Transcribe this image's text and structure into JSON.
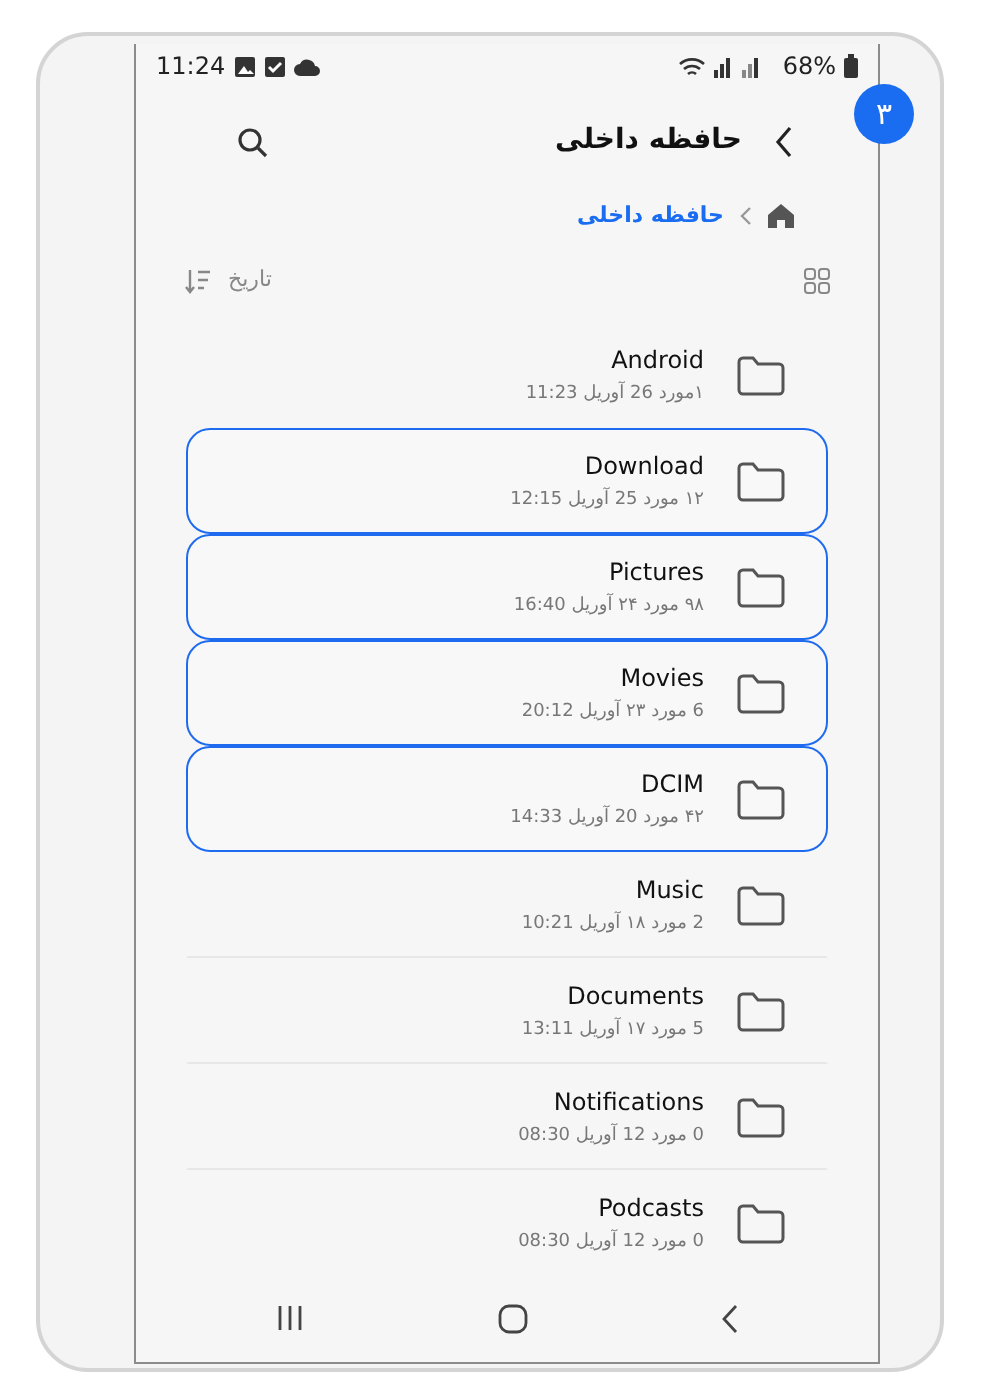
{
  "status_bar": {
    "time": "11:24",
    "battery": "68%"
  },
  "step_badge": "۳",
  "header": {
    "title": "حافظه داخلی"
  },
  "breadcrumb": [
    {
      "label": "حافظه داخلی"
    }
  ],
  "sort": {
    "label": "تاریخ"
  },
  "folders": [
    {
      "name": "Android",
      "meta": "۱مورد 26 آوریل 11:23",
      "selected": false
    },
    {
      "name": "Download",
      "meta": "۱۲ مورد 25 آوریل 12:15",
      "selected": true
    },
    {
      "name": "Pictures",
      "meta": "۹۸ مورد ۲۴ آوریل 16:40",
      "selected": true
    },
    {
      "name": "Movies",
      "meta": "6 مورد ۲۳ آوریل 20:12",
      "selected": true
    },
    {
      "name": "DCIM",
      "meta": "۴۲ مورد 20 آوریل 14:33",
      "selected": true
    },
    {
      "name": "Music",
      "meta": "2 مورد ۱۸ آوریل 10:21",
      "selected": false
    },
    {
      "name": "Documents",
      "meta": "5 مورد ۱۷ آوریل 13:11",
      "selected": false
    },
    {
      "name": "Notifications",
      "meta": "0 مورد 12 آوریل 08:30",
      "selected": false
    },
    {
      "name": "Podcasts",
      "meta": "0 مورد 12 آوریل 08:30",
      "selected": false
    }
  ]
}
